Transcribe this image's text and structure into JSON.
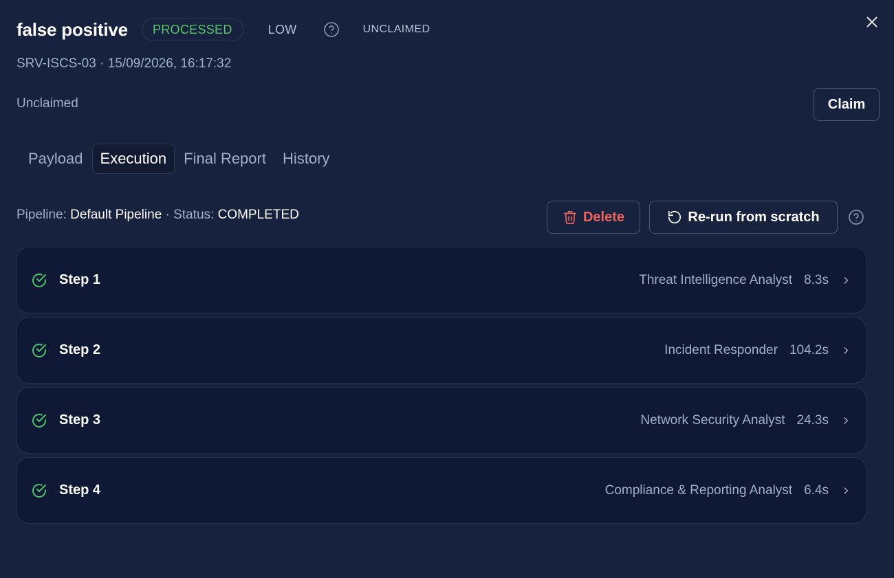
{
  "alert": {
    "title": "false positive",
    "status_badge": "PROCESSED",
    "severity": "LOW",
    "claim_state": "UNCLAIMED",
    "meta": "SRV-ISCS-03 · 15/09/2026, 16:17:32",
    "assignee": "Unclaimed",
    "claim_label": "Claim"
  },
  "tabs": [
    {
      "label": "Payload"
    },
    {
      "label": "Execution"
    },
    {
      "label": "Final Report"
    },
    {
      "label": "History"
    }
  ],
  "execution": {
    "pipeline_label": "Pipeline:",
    "pipeline_value": "Default Pipeline",
    "separator": " · ",
    "status_label": "Status:",
    "status_value": "COMPLETED",
    "delete_label": "Delete",
    "rerun_label": "Re-run from scratch"
  },
  "steps": [
    {
      "name": "Step 1",
      "agent": "Threat Intelligence Analyst",
      "duration": "8.3s"
    },
    {
      "name": "Step 2",
      "agent": "Incident Responder",
      "duration": "104.2s"
    },
    {
      "name": "Step 3",
      "agent": "Network Security Analyst",
      "duration": "24.3s"
    },
    {
      "name": "Step 4",
      "agent": "Compliance & Reporting Analyst",
      "duration": "6.4s"
    }
  ],
  "icons": {
    "close": "close-icon",
    "help": "help-circle-icon",
    "trash": "trash-icon",
    "rerun": "rotate-ccw-icon",
    "check": "check-circle-icon",
    "chevron": "chevron-right-icon"
  },
  "colors": {
    "background": "#17223f",
    "processed": "#5cc76a",
    "danger": "#f0625c",
    "success": "#4cc36a",
    "muted_text": "#9fb0cc"
  }
}
